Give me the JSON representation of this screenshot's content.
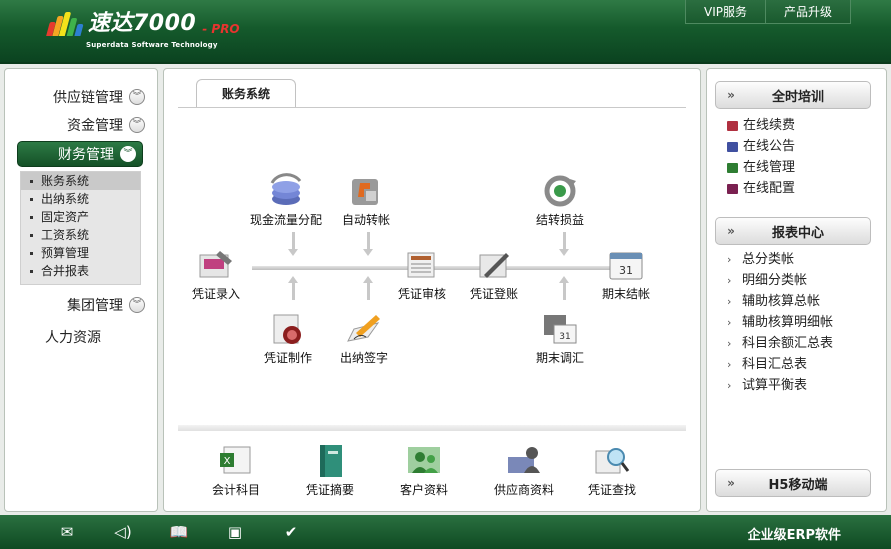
{
  "header": {
    "brand": "速达7000",
    "edition": "- PRO",
    "subtitle": "Superdata Software Technology",
    "buttons": [
      "VIP服务",
      "产品升级"
    ]
  },
  "sidebar": {
    "items": [
      {
        "label": "供应链管理"
      },
      {
        "label": "资金管理"
      },
      {
        "label": "财务管理",
        "active": true
      },
      {
        "label": "集团管理"
      },
      {
        "label": "人力资源"
      }
    ],
    "submenu": [
      "账务系统",
      "出纳系统",
      "固定资产",
      "工资系统",
      "预算管理",
      "合并报表"
    ],
    "selected_sub": "账务系统"
  },
  "main": {
    "tab": "账务系统",
    "flow": {
      "cash_flow": "现金流量分配",
      "auto_transfer": "自动转帐",
      "carry_forward": "结转损益",
      "voucher_entry": "凭证录入",
      "voucher_review": "凭证审核",
      "voucher_posting": "凭证登账",
      "period_close": "期末结帐",
      "voucher_make": "凭证制作",
      "cashier_sign": "出纳签字",
      "period_adjust": "期末调汇"
    },
    "bottom": [
      "会计科目",
      "凭证摘要",
      "客户资料",
      "供应商资料",
      "凭证查找"
    ]
  },
  "right": {
    "training": {
      "title": "全时培训",
      "links": [
        "在线续费",
        "在线公告",
        "在线管理",
        "在线配置"
      ]
    },
    "reports": {
      "title": "报表中心",
      "links": [
        "总分类帐",
        "明细分类帐",
        "辅助核算总帐",
        "辅助核算明细帐",
        "科目余额汇总表",
        "科目汇总表",
        "试算平衡表"
      ]
    },
    "mobile": {
      "title": "H5移动端"
    }
  },
  "footer": {
    "icons": [
      "mail-icon",
      "speaker-icon",
      "book-icon",
      "window-icon",
      "check-icon"
    ],
    "text": "企业级ERP软件"
  }
}
